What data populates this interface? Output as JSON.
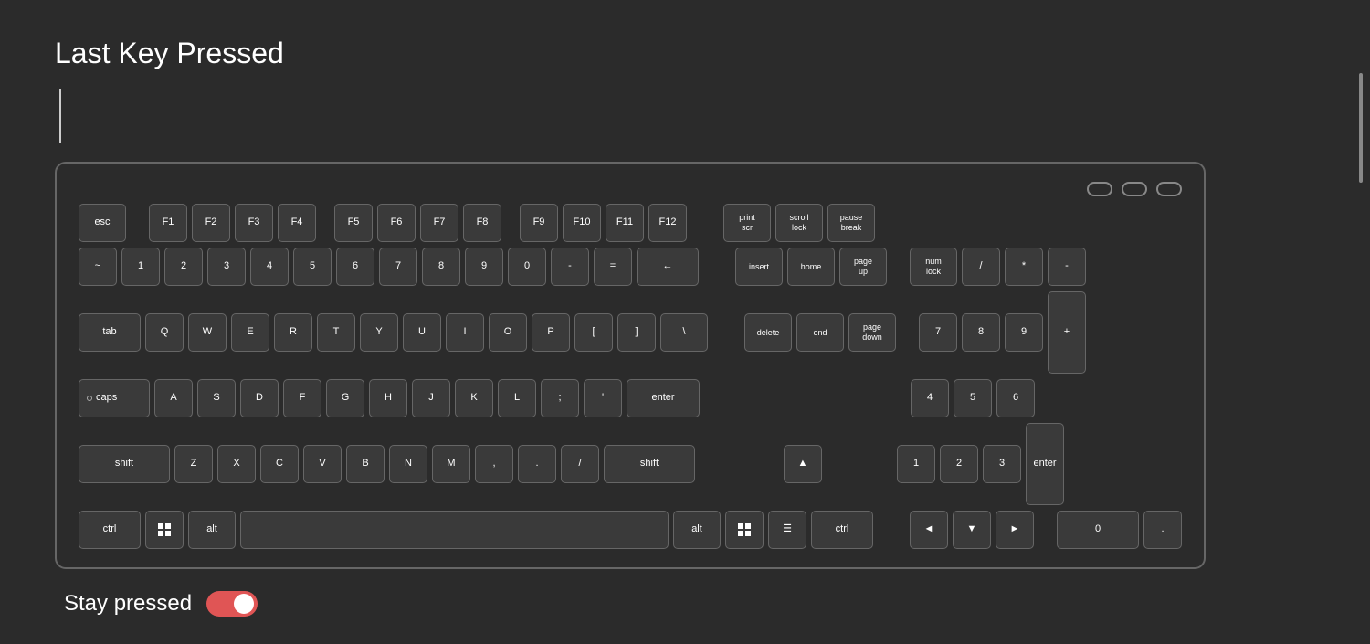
{
  "page": {
    "title": "Last Key Pressed",
    "last_key_text": "",
    "stay_pressed_label": "Stay pressed",
    "stay_pressed_active": true
  },
  "keyboard": {
    "rows": {
      "fn_row": [
        "esc",
        "F1",
        "F2",
        "F3",
        "F4",
        "F5",
        "F6",
        "F7",
        "F8",
        "F9",
        "F10",
        "F11",
        "F12",
        "print scr",
        "scroll lock",
        "pause break"
      ],
      "number_row": [
        "~",
        "1",
        "2",
        "3",
        "4",
        "5",
        "6",
        "7",
        "8",
        "9",
        "0",
        "-",
        "=",
        "←"
      ],
      "top_alpha": [
        "tab",
        "Q",
        "W",
        "E",
        "R",
        "T",
        "Y",
        "U",
        "I",
        "O",
        "P",
        "[",
        "]",
        "\\"
      ],
      "mid_alpha": [
        "caps",
        "A",
        "S",
        "D",
        "F",
        "G",
        "H",
        "J",
        "K",
        "L",
        ";",
        "'",
        "enter"
      ],
      "bot_alpha": [
        "shift",
        "Z",
        "X",
        "C",
        "V",
        "B",
        "N",
        "M",
        ",",
        ".",
        "/",
        "shift"
      ],
      "bottom_row": [
        "ctrl",
        "win",
        "alt",
        "space",
        "alt",
        "win",
        "menu",
        "ctrl"
      ],
      "nav": [
        "insert",
        "home",
        "page up",
        "delete",
        "end",
        "page down"
      ],
      "arrows": [
        "▲",
        "◄",
        "▼",
        "►"
      ],
      "numpad": [
        "num lock",
        "/",
        "*",
        "-",
        "7",
        "8",
        "9",
        "+",
        "4",
        "5",
        "6",
        "1",
        "2",
        "3",
        "enter",
        "0",
        "."
      ]
    },
    "indicators": [
      "oval1",
      "oval2",
      "oval3"
    ]
  }
}
